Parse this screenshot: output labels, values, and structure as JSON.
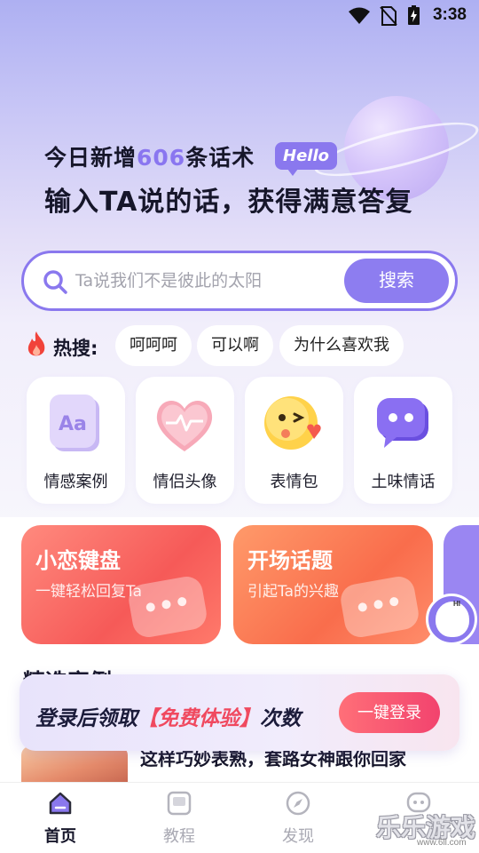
{
  "status_bar": {
    "time": "3:38",
    "icons": [
      "wifi-icon",
      "no-sim-icon",
      "battery-charging-icon"
    ]
  },
  "hero": {
    "line1_prefix": "今日新增",
    "line1_count": "606",
    "line1_suffix": "条话术",
    "badge": "Hello",
    "line2": "输入TA说的话，获得满意答复"
  },
  "search": {
    "placeholder": "Ta说我们不是彼此的太阳",
    "button_label": "搜索"
  },
  "hot": {
    "label": "热搜:",
    "tags": [
      "呵呵呵",
      "可以啊",
      "为什么喜欢我"
    ]
  },
  "features": [
    {
      "label": "情感案例",
      "icon": "aa-card-icon"
    },
    {
      "label": "情侣头像",
      "icon": "heart-pulse-icon"
    },
    {
      "label": "表情包",
      "icon": "wink-emoji-icon"
    },
    {
      "label": "土味情话",
      "icon": "chat-bubble-icon"
    }
  ],
  "promo_cards": [
    {
      "title": "小恋键盘",
      "subtitle": "一键轻松回复Ta",
      "color": "#f7615e",
      "icon": "keyboard-icon"
    },
    {
      "title": "开场话题",
      "subtitle": "引起Ta的兴趣",
      "color": "#f96d4c",
      "icon": "chat-dots-icon"
    }
  ],
  "section": {
    "title": "精选案例",
    "article_title": "这样巧妙表熟，套路女神跟你回家"
  },
  "login_banner": {
    "text_prefix": "登录后领取",
    "text_highlight": "【免费体验】",
    "text_suffix": "次数",
    "button_label": "一键登录"
  },
  "tabbar": {
    "tabs": [
      {
        "label": "首页",
        "icon": "home-icon",
        "active": true
      },
      {
        "label": "教程",
        "icon": "book-icon",
        "active": false
      },
      {
        "label": "发现",
        "icon": "compass-icon",
        "active": false
      },
      {
        "label": "",
        "icon": "chat-face-icon",
        "active": false
      }
    ]
  },
  "watermark": {
    "text": "乐乐游戏",
    "url": "www.6ll.com"
  },
  "colors": {
    "accent": "#8a78ee",
    "promo_red": "#f7615e",
    "promo_orange": "#f96d4c",
    "login_button": "#f2436e"
  }
}
